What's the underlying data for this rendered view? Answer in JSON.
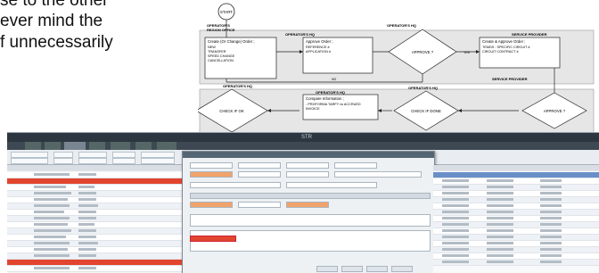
{
  "body_text": {
    "line1": "se to the other",
    "line2": "ever mind the",
    "line3": "f unnecessarily"
  },
  "flowchart": {
    "start": "START",
    "lane_left_top": "OPERATOR'S\nREGION OFFICE",
    "lane_hq_top": "OPERATOR'S HQ",
    "lane_hq_diamond_top": "OPERATOR'S HQ",
    "lane_provider_top": "SERVICE PROVIDER",
    "lane_provider_mid": "SERVICE PROVIDER",
    "lane_hq_left_mid": "OPERATOR'S HQ",
    "lane_hq_center_mid": "OPERATOR'S HQ",
    "lane_hq_diamond_mid": "OPERATOR'S HQ",
    "box1_title": "Create (Or Change) Order ;",
    "box1_items": [
      "NEW",
      "TRANSFER",
      "SPEED CHANGE",
      "CANCELLATION"
    ],
    "box2_title": "Approve Order ;",
    "box2_items": [
      "REFERENCE #",
      "APPLICATION #"
    ],
    "box3_title": "Create & Approve Order ;",
    "box3_items": [
      "TEMDS : SPECIFIC CIRCUIT #",
      "CIRCUIT CONTRACT #"
    ],
    "box4_title": "Compare Information ;",
    "box4_items": [
      "PROFORMA TARFY vs ACCRUED INVOICE"
    ],
    "diamond_approve_top": "APPROVE ?",
    "diamond_check_ok": "CHECK IF OK",
    "diamond_check_done": "CHECK IF DONE",
    "diamond_approve_mid": "APPROVE ?",
    "yes_label": "YES",
    "no_label": "NO"
  },
  "screenshot": {
    "app_title": "STR"
  },
  "colors": {
    "flow_box": "#ffffff",
    "flow_border": "#222222",
    "lane_fill": "#e6e6e6",
    "grid_highlight": "#e2452f",
    "dialog_accent": "#f2a36b"
  }
}
